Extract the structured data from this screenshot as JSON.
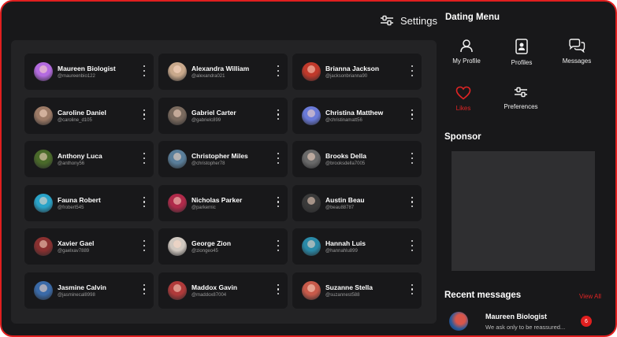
{
  "settings": {
    "label": "Settings",
    "icon": "sliders-icon"
  },
  "profiles": [
    {
      "name": "Maureen Biologist",
      "handle": "@maureenbio122",
      "avatar_color": "#b46be0"
    },
    {
      "name": "Alexandra William",
      "handle": "@alexandra021",
      "avatar_color": "#c9a98c"
    },
    {
      "name": "Brianna Jackson",
      "handle": "@jacksonbrianna90",
      "avatar_color": "#c0392b"
    },
    {
      "name": "Caroline Daniel",
      "handle": "@caroline_d105",
      "avatar_color": "#9c7a66"
    },
    {
      "name": "Gabriel Carter",
      "handle": "@gabrielc899",
      "avatar_color": "#7a6a5e"
    },
    {
      "name": "Christina Matthew",
      "handle": "@christinamatt56",
      "avatar_color": "#6a7ad8"
    },
    {
      "name": "Anthony Luca",
      "handle": "@anthony56",
      "avatar_color": "#4a6a2a"
    },
    {
      "name": "Christopher Miles",
      "handle": "@christopher78",
      "avatar_color": "#5a7e9a"
    },
    {
      "name": "Brooks Della",
      "handle": "@brooksdella7005",
      "avatar_color": "#6a6a6a"
    },
    {
      "name": "Fauna Robert",
      "handle": "@frobert545",
      "avatar_color": "#2aa3c8"
    },
    {
      "name": "Nicholas Parker",
      "handle": "@parkernic",
      "avatar_color": "#b02a4a"
    },
    {
      "name": "Austin Beau",
      "handle": "@beau88787",
      "avatar_color": "#3a3a3a"
    },
    {
      "name": "Xavier Gael",
      "handle": "@gaelxav7889",
      "avatar_color": "#8a3030"
    },
    {
      "name": "George Zion",
      "handle": "@ziongeo45",
      "avatar_color": "#d0c8c0"
    },
    {
      "name": "Hannah Luis",
      "handle": "@hannahlu899",
      "avatar_color": "#2a8aa8"
    },
    {
      "name": "Jasmine Calvin",
      "handle": "@jasminecal8998",
      "avatar_color": "#3a6aa8"
    },
    {
      "name": "Maddox Gavin",
      "handle": "@maddox87004",
      "avatar_color": "#b03a3a"
    },
    {
      "name": "Suzanne Stella",
      "handle": "@suzannest588",
      "avatar_color": "#c85a4a"
    }
  ],
  "menu": {
    "title": "Dating Menu",
    "items": [
      {
        "label": "My Profile",
        "icon": "user-icon"
      },
      {
        "label": "Profiles",
        "icon": "id-card-icon"
      },
      {
        "label": "Messages",
        "icon": "chat-bubbles-icon"
      },
      {
        "label": "Likes",
        "icon": "heart-icon"
      },
      {
        "label": "Preferences",
        "icon": "sliders-icon"
      }
    ]
  },
  "sponsor": {
    "title": "Sponsor"
  },
  "recent": {
    "title": "Recent messages",
    "view_all": "View All",
    "message": {
      "name": "Maureen Biologist",
      "text": "We ask only to be reassured...",
      "unread_count": "6"
    }
  },
  "colors": {
    "accent": "#e01f1f",
    "background": "#18181a",
    "panel": "#232325"
  }
}
